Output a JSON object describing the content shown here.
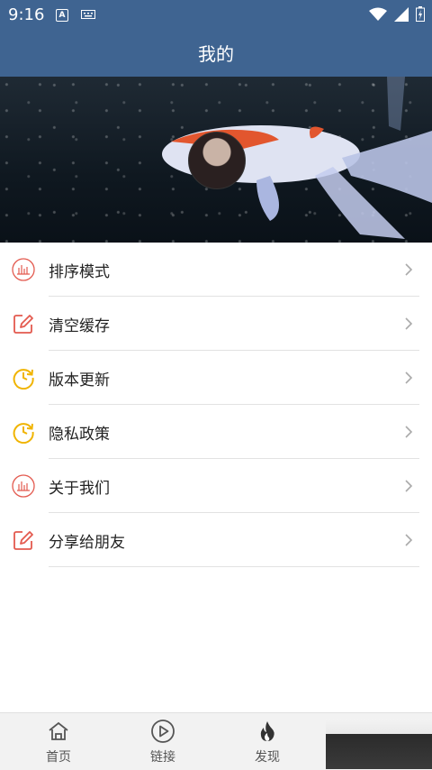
{
  "status_bar": {
    "time": "9:16",
    "app_icon_letter": "A"
  },
  "header": {
    "title": "我的"
  },
  "menu": [
    {
      "label": "排序模式",
      "icon": "bar-chart-circle-icon"
    },
    {
      "label": "清空缓存",
      "icon": "edit-square-icon"
    },
    {
      "label": "版本更新",
      "icon": "clock-refresh-icon"
    },
    {
      "label": "隐私政策",
      "icon": "clock-refresh-icon"
    },
    {
      "label": "关于我们",
      "icon": "bar-chart-circle-icon"
    },
    {
      "label": "分享给朋友",
      "icon": "edit-square-icon"
    }
  ],
  "tabs": [
    {
      "label": "首页",
      "icon": "home-icon"
    },
    {
      "label": "链接",
      "icon": "play-circle-icon"
    },
    {
      "label": "发现",
      "icon": "flame-icon"
    }
  ],
  "colors": {
    "header_bg": "#3f6491",
    "icon_red": "#e35a4f",
    "icon_yellow": "#f0b400",
    "tabbar_bg": "#f2f2f2"
  }
}
